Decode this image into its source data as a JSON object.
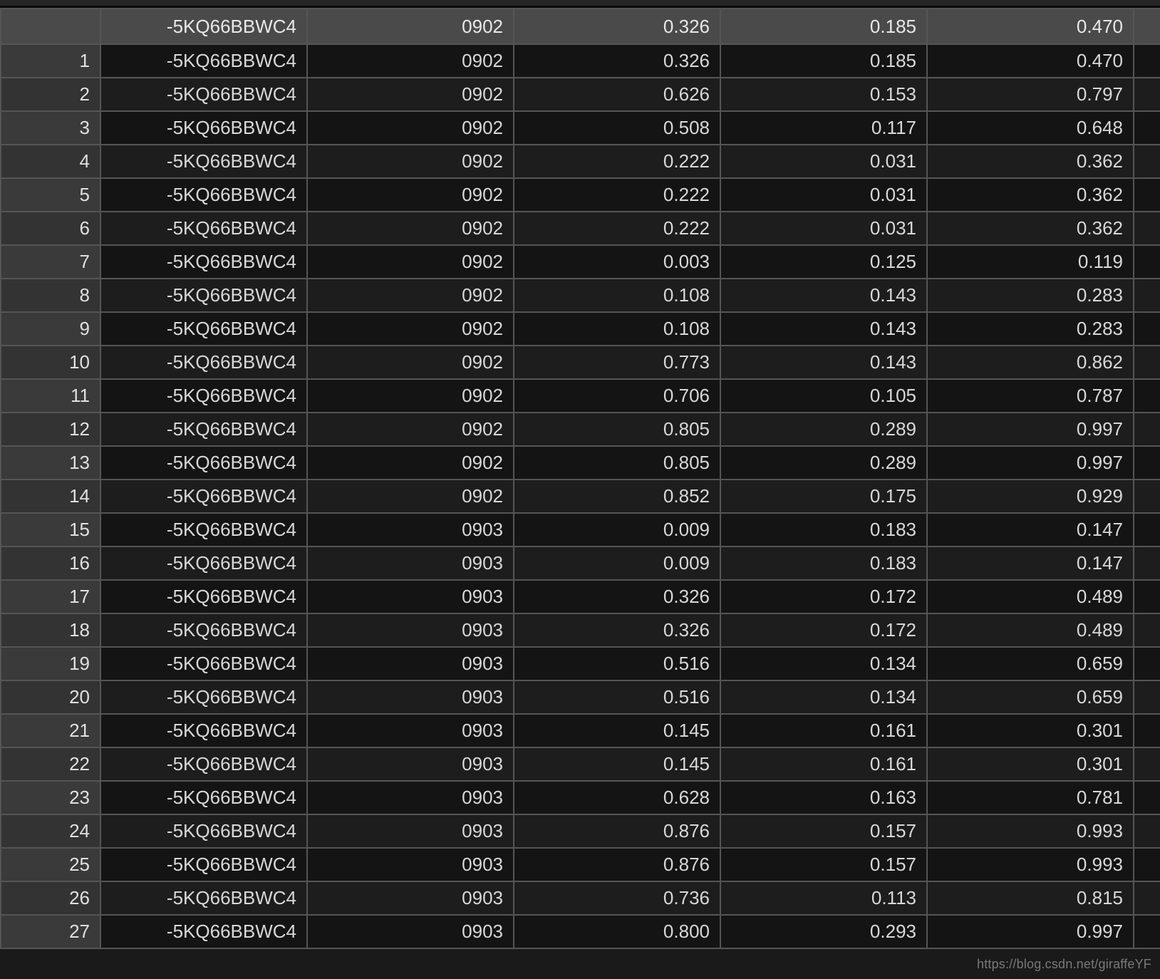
{
  "header": {
    "index": "",
    "cols": [
      "-5KQ66BBWC4",
      "0902",
      "0.326",
      "0.185",
      "0.470"
    ]
  },
  "rows": [
    {
      "index": "1",
      "code": "-5KQ66BBWC4",
      "num": "0902",
      "v1": "0.326",
      "v2": "0.185",
      "v3": "0.470"
    },
    {
      "index": "2",
      "code": "-5KQ66BBWC4",
      "num": "0902",
      "v1": "0.626",
      "v2": "0.153",
      "v3": "0.797"
    },
    {
      "index": "3",
      "code": "-5KQ66BBWC4",
      "num": "0902",
      "v1": "0.508",
      "v2": "0.117",
      "v3": "0.648"
    },
    {
      "index": "4",
      "code": "-5KQ66BBWC4",
      "num": "0902",
      "v1": "0.222",
      "v2": "0.031",
      "v3": "0.362"
    },
    {
      "index": "5",
      "code": "-5KQ66BBWC4",
      "num": "0902",
      "v1": "0.222",
      "v2": "0.031",
      "v3": "0.362"
    },
    {
      "index": "6",
      "code": "-5KQ66BBWC4",
      "num": "0902",
      "v1": "0.222",
      "v2": "0.031",
      "v3": "0.362"
    },
    {
      "index": "7",
      "code": "-5KQ66BBWC4",
      "num": "0902",
      "v1": "0.003",
      "v2": "0.125",
      "v3": "0.119"
    },
    {
      "index": "8",
      "code": "-5KQ66BBWC4",
      "num": "0902",
      "v1": "0.108",
      "v2": "0.143",
      "v3": "0.283"
    },
    {
      "index": "9",
      "code": "-5KQ66BBWC4",
      "num": "0902",
      "v1": "0.108",
      "v2": "0.143",
      "v3": "0.283"
    },
    {
      "index": "10",
      "code": "-5KQ66BBWC4",
      "num": "0902",
      "v1": "0.773",
      "v2": "0.143",
      "v3": "0.862"
    },
    {
      "index": "11",
      "code": "-5KQ66BBWC4",
      "num": "0902",
      "v1": "0.706",
      "v2": "0.105",
      "v3": "0.787"
    },
    {
      "index": "12",
      "code": "-5KQ66BBWC4",
      "num": "0902",
      "v1": "0.805",
      "v2": "0.289",
      "v3": "0.997"
    },
    {
      "index": "13",
      "code": "-5KQ66BBWC4",
      "num": "0902",
      "v1": "0.805",
      "v2": "0.289",
      "v3": "0.997"
    },
    {
      "index": "14",
      "code": "-5KQ66BBWC4",
      "num": "0902",
      "v1": "0.852",
      "v2": "0.175",
      "v3": "0.929"
    },
    {
      "index": "15",
      "code": "-5KQ66BBWC4",
      "num": "0903",
      "v1": "0.009",
      "v2": "0.183",
      "v3": "0.147"
    },
    {
      "index": "16",
      "code": "-5KQ66BBWC4",
      "num": "0903",
      "v1": "0.009",
      "v2": "0.183",
      "v3": "0.147"
    },
    {
      "index": "17",
      "code": "-5KQ66BBWC4",
      "num": "0903",
      "v1": "0.326",
      "v2": "0.172",
      "v3": "0.489"
    },
    {
      "index": "18",
      "code": "-5KQ66BBWC4",
      "num": "0903",
      "v1": "0.326",
      "v2": "0.172",
      "v3": "0.489"
    },
    {
      "index": "19",
      "code": "-5KQ66BBWC4",
      "num": "0903",
      "v1": "0.516",
      "v2": "0.134",
      "v3": "0.659"
    },
    {
      "index": "20",
      "code": "-5KQ66BBWC4",
      "num": "0903",
      "v1": "0.516",
      "v2": "0.134",
      "v3": "0.659"
    },
    {
      "index": "21",
      "code": "-5KQ66BBWC4",
      "num": "0903",
      "v1": "0.145",
      "v2": "0.161",
      "v3": "0.301"
    },
    {
      "index": "22",
      "code": "-5KQ66BBWC4",
      "num": "0903",
      "v1": "0.145",
      "v2": "0.161",
      "v3": "0.301"
    },
    {
      "index": "23",
      "code": "-5KQ66BBWC4",
      "num": "0903",
      "v1": "0.628",
      "v2": "0.163",
      "v3": "0.781"
    },
    {
      "index": "24",
      "code": "-5KQ66BBWC4",
      "num": "0903",
      "v1": "0.876",
      "v2": "0.157",
      "v3": "0.993"
    },
    {
      "index": "25",
      "code": "-5KQ66BBWC4",
      "num": "0903",
      "v1": "0.876",
      "v2": "0.157",
      "v3": "0.993"
    },
    {
      "index": "26",
      "code": "-5KQ66BBWC4",
      "num": "0903",
      "v1": "0.736",
      "v2": "0.113",
      "v3": "0.815"
    },
    {
      "index": "27",
      "code": "-5KQ66BBWC4",
      "num": "0903",
      "v1": "0.800",
      "v2": "0.293",
      "v3": "0.997"
    }
  ],
  "watermark": "https://blog.csdn.net/giraffeYF"
}
